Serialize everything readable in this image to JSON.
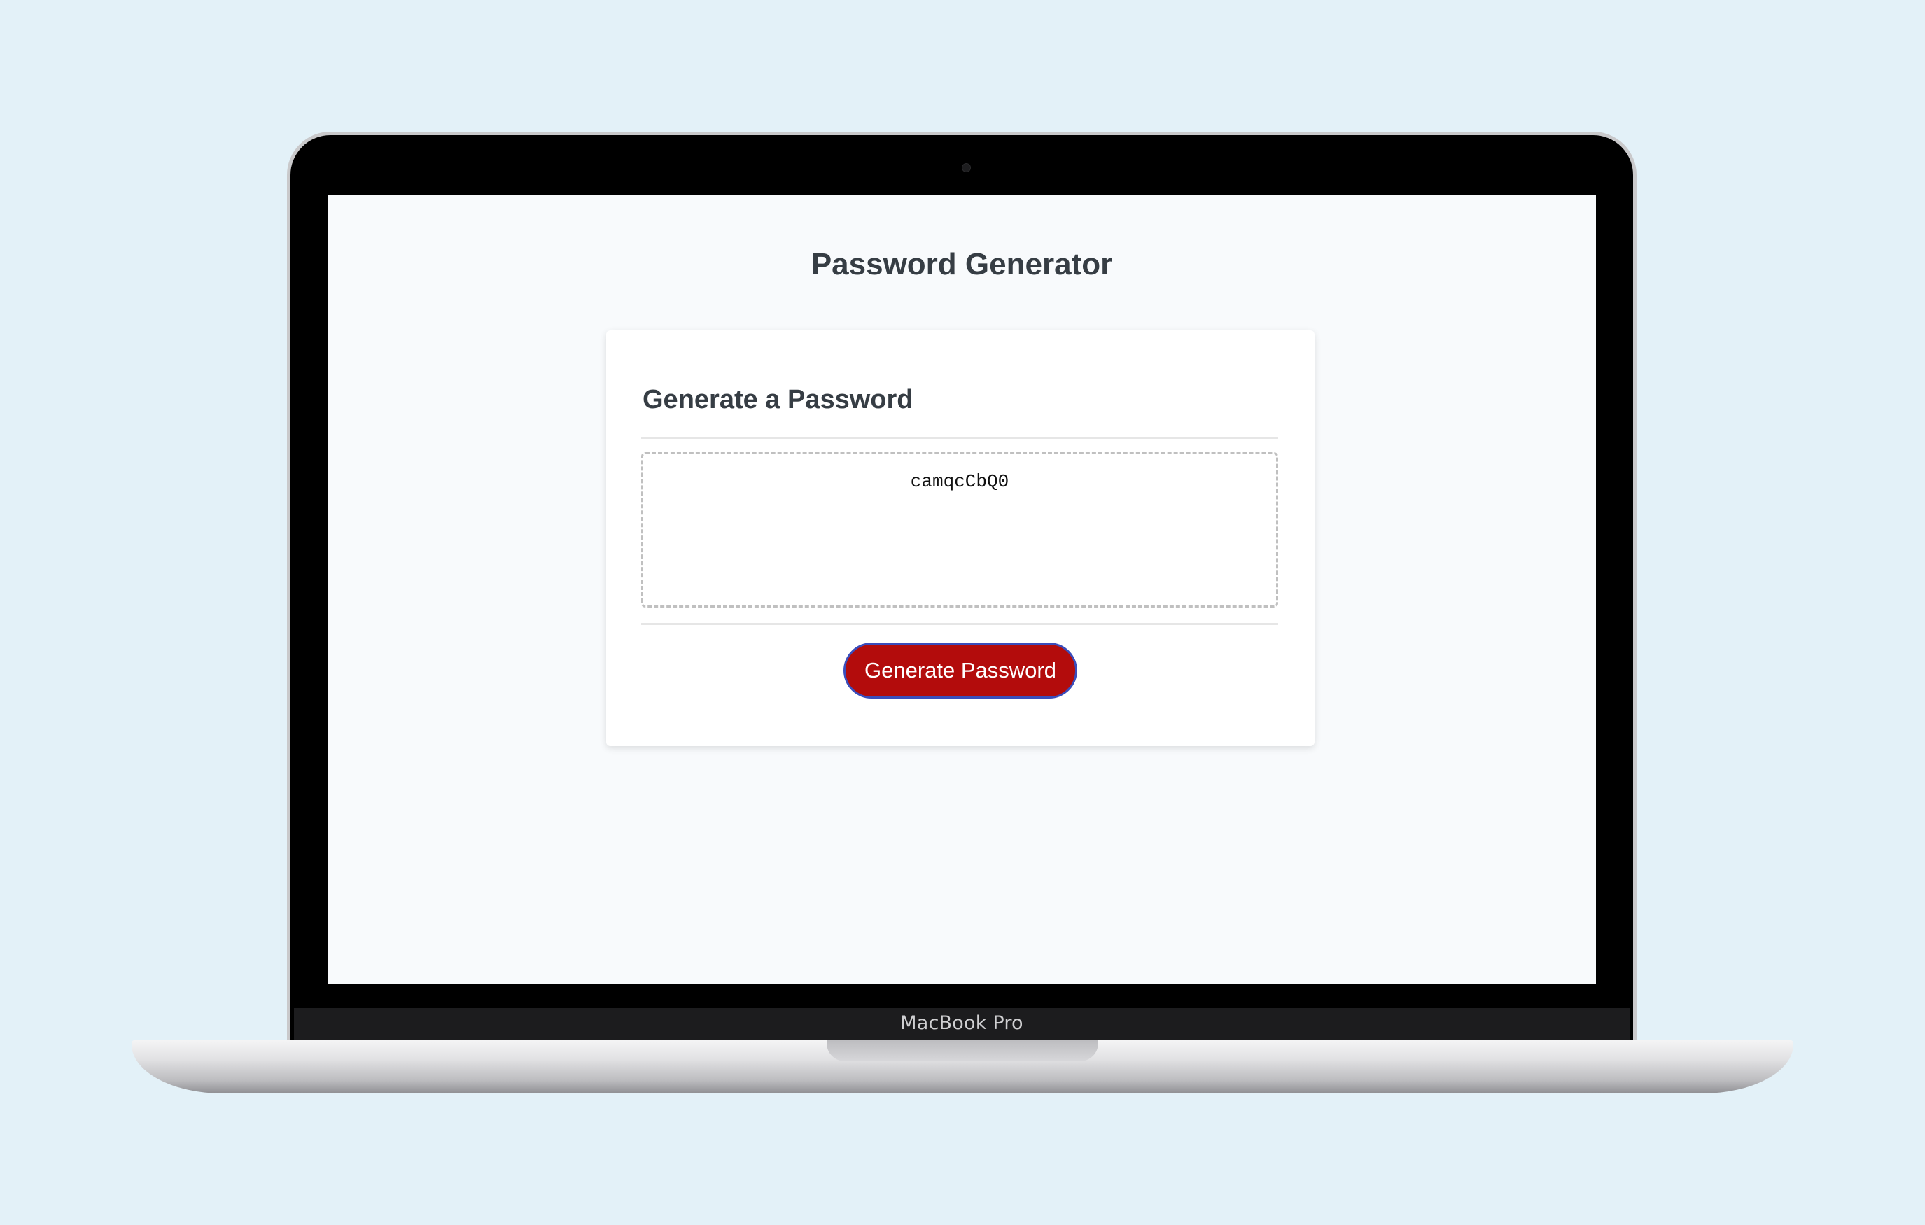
{
  "app": {
    "title": "Password Generator"
  },
  "card": {
    "header": "Generate a Password",
    "output_value": "camqcCbQ0",
    "button_label": "Generate Password"
  },
  "device": {
    "brand": "MacBook Pro"
  },
  "colors": {
    "background": "#e3f1f8",
    "screen": "#f8fafc",
    "heading_text": "#363d44",
    "button_fill": "#b30c0c",
    "button_border": "#3a4dbb"
  },
  "icons": {
    "camera": "camera-icon"
  }
}
